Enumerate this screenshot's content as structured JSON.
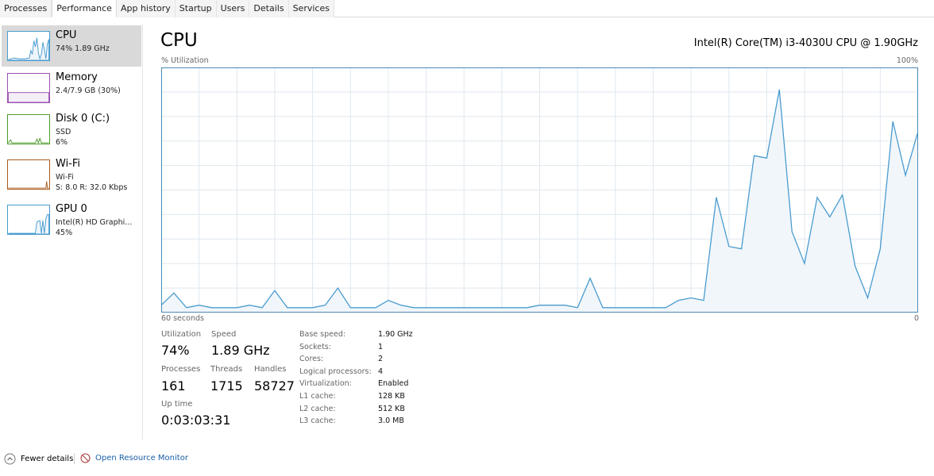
{
  "tabs": [
    "Processes",
    "Performance",
    "App history",
    "Startup",
    "Users",
    "Details",
    "Services"
  ],
  "active_tab": "Performance",
  "sidebar": [
    {
      "title": "CPU",
      "line1": "74% 1.89 GHz",
      "color": "#4a9ccf"
    },
    {
      "title": "Memory",
      "line1": "2.4/7.9 GB (30%)",
      "color": "#9b4fb0"
    },
    {
      "title": "Disk 0 (C:)",
      "line1": "SSD",
      "line2": "6%",
      "color": "#4d9a2a"
    },
    {
      "title": "Wi-Fi",
      "line1": "Wi-Fi",
      "line2": "S: 8.0 R: 32.0 Kbps",
      "color": "#a75a1c"
    },
    {
      "title": "GPU 0",
      "line1": "Intel(R) HD Graphi...",
      "line2": "45%",
      "color": "#4a9ccf"
    }
  ],
  "header": {
    "title": "CPU",
    "cpu_name": "Intel(R) Core(TM) i3-4030U CPU @ 1.90GHz",
    "util_label": "% Utilization",
    "max_label": "100%",
    "time_label": "60 seconds",
    "min_label": "0"
  },
  "chart_data": {
    "type": "area",
    "xlim": [
      60,
      0
    ],
    "ylim": [
      0,
      100
    ],
    "grid": true,
    "color": "#4a9ccf",
    "values": [
      3,
      8,
      2,
      3,
      2,
      2,
      2,
      3,
      2,
      9,
      2,
      2,
      2,
      3,
      10,
      2,
      2,
      2,
      5,
      3,
      2,
      2,
      2,
      2,
      2,
      2,
      2,
      2,
      2,
      2,
      3,
      3,
      3,
      2,
      14,
      2,
      2,
      2,
      2,
      2,
      2,
      5,
      6,
      5,
      47,
      27,
      26,
      64,
      63,
      91,
      33,
      20,
      47,
      39,
      48,
      19,
      6,
      26,
      78,
      56,
      74
    ]
  },
  "stats": {
    "utilization_label": "Utilization",
    "utilization": "74%",
    "speed_label": "Speed",
    "speed": "1.89 GHz",
    "processes_label": "Processes",
    "processes": "161",
    "threads_label": "Threads",
    "threads": "1715",
    "handles_label": "Handles",
    "handles": "58727",
    "uptime_label": "Up time",
    "uptime": "0:03:03:31"
  },
  "specs": [
    [
      "Base speed:",
      "1.90 GHz"
    ],
    [
      "Sockets:",
      "1"
    ],
    [
      "Cores:",
      "2"
    ],
    [
      "Logical processors:",
      "4"
    ],
    [
      "Virtualization:",
      "Enabled"
    ],
    [
      "L1 cache:",
      "128 KB"
    ],
    [
      "L2 cache:",
      "512 KB"
    ],
    [
      "L3 cache:",
      "3.0 MB"
    ]
  ],
  "footer": {
    "fewer_details": "Fewer details",
    "resource_monitor": "Open Resource Monitor"
  }
}
